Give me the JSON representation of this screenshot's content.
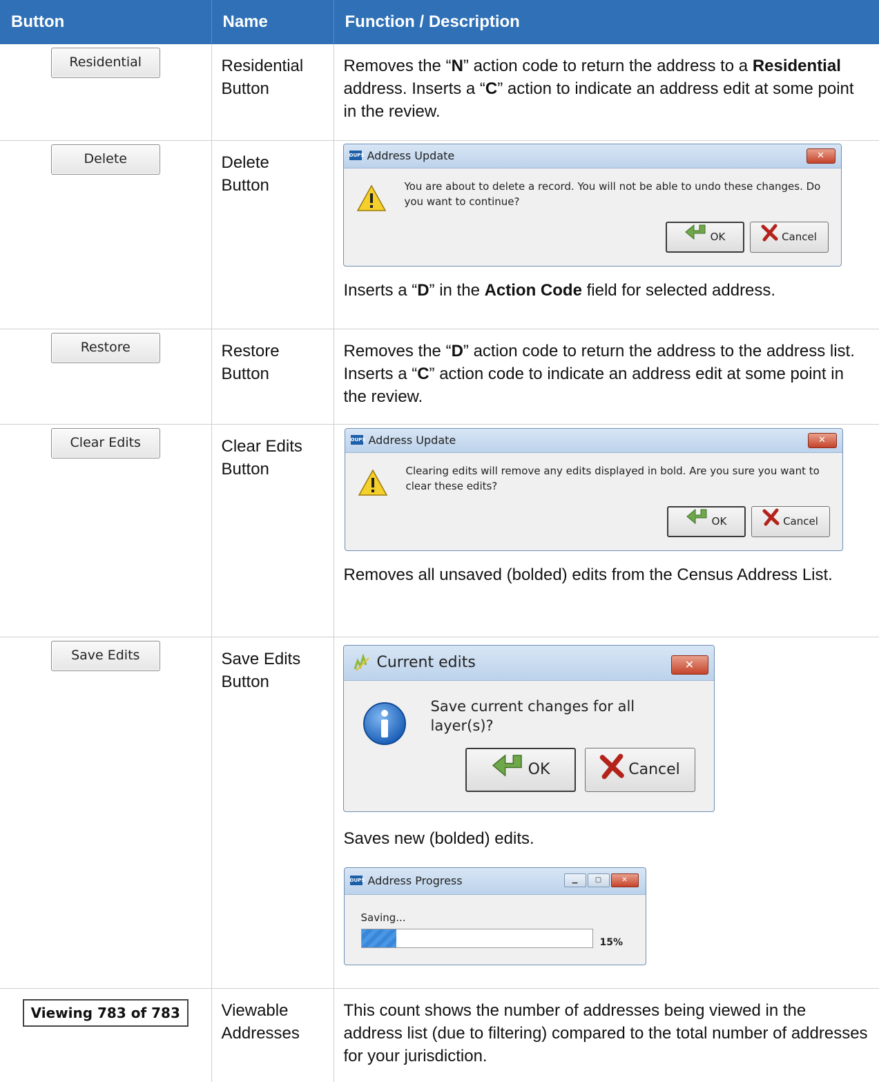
{
  "header": {
    "col_button": "Button",
    "col_name": "Name",
    "col_function": "Function / Description"
  },
  "rows": {
    "residential": {
      "button_label": "Residential",
      "name_line1": "Residential",
      "name_line2": "Button",
      "desc": [
        {
          "t": "Removes the “",
          "b": false
        },
        {
          "t": "N",
          "b": true
        },
        {
          "t": "” action code to return the address to a ",
          "b": false
        },
        {
          "t": "Residential",
          "b": true
        },
        {
          "t": " address. Inserts a “",
          "b": false
        },
        {
          "t": "C",
          "b": true
        },
        {
          "t": "” action to indicate an address edit at some point in the review.",
          "b": false
        }
      ]
    },
    "delete": {
      "button_label": "Delete",
      "name_line1": "Delete",
      "name_line2": "Button",
      "dialog": {
        "icon_text": "OUPS",
        "title": "Address Update",
        "close": "✕",
        "message": "You are about to delete a record. You will not be able to undo these changes. Do you want to continue?",
        "ok": "OK",
        "cancel": "Cancel"
      },
      "desc": [
        {
          "t": "Inserts a “",
          "b": false
        },
        {
          "t": "D",
          "b": true
        },
        {
          "t": "” in the ",
          "b": false
        },
        {
          "t": "Action Code",
          "b": true
        },
        {
          "t": " field for selected address.",
          "b": false
        }
      ]
    },
    "restore": {
      "button_label": "Restore",
      "name_line1": "Restore",
      "name_line2": "Button",
      "desc": [
        {
          "t": "Removes the “",
          "b": false
        },
        {
          "t": "D",
          "b": true
        },
        {
          "t": "” action code to return the address to the address list. Inserts a “",
          "b": false
        },
        {
          "t": "C",
          "b": true
        },
        {
          "t": "” action code to indicate an address edit at some point in the review.",
          "b": false
        }
      ]
    },
    "clear_edits": {
      "button_label": "Clear Edits",
      "name_line1": "Clear Edits",
      "name_line2": "Button",
      "dialog": {
        "icon_text": "OUPS",
        "title": "Address Update",
        "close": "✕",
        "message": "Clearing edits will remove any edits displayed in bold. Are you sure you want to clear these edits?",
        "ok": "OK",
        "cancel": "Cancel"
      },
      "desc_text": "Removes all unsaved (bolded) edits from the Census Address List."
    },
    "save_edits": {
      "button_label": "Save Edits",
      "name_line1": "Save Edits",
      "name_line2": "Button",
      "dialog": {
        "title": "Current edits",
        "close": "✕",
        "message": "Save current changes for all layer(s)?",
        "ok": "OK",
        "cancel": "Cancel"
      },
      "desc_text": "Saves new (bolded) edits.",
      "progress": {
        "icon_text": "OUPS",
        "title": "Address Progress",
        "status": "Saving...",
        "percent_label": "15%",
        "fraction": 0.15
      }
    },
    "viewable": {
      "button_label": "Viewing 783 of 783",
      "name_line1": "Viewable",
      "name_line2": "Addresses",
      "desc_text": "This count shows the number of addresses being viewed in the address list (due to filtering) compared to the total number of addresses for your jurisdiction."
    }
  },
  "colors": {
    "header_bg": "#2f70b6",
    "close_red": "#c5432b",
    "progress_blue": "#3a86d8"
  },
  "icons": [
    "warning-icon",
    "info-icon",
    "green-arrow-ok-icon",
    "red-x-cancel-icon",
    "pencil-app-icon"
  ]
}
